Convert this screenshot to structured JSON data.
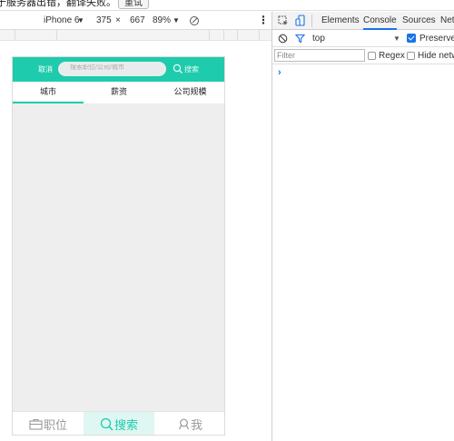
{
  "translate_bar": {
    "message": "于服务器出错，翻译失败。",
    "retry": "重试"
  },
  "device_toolbar": {
    "device": "iPhone 6",
    "device_arrow": "▼",
    "width": "375",
    "times": "×",
    "height": "667",
    "zoom": "89%",
    "zoom_arrow": "▼",
    "more": "⋮"
  },
  "app": {
    "cancel": "取消",
    "search_placeholder": "搜索职位/公司/城市",
    "search_button": "搜索",
    "tabs": [
      "城市",
      "薪资",
      "公司规模"
    ],
    "nav": {
      "jobs": "职位",
      "search": "搜索",
      "me": "我"
    },
    "accent": "#1ecbad"
  },
  "devtools": {
    "tabs": [
      "Elements",
      "Console",
      "Sources",
      "Net"
    ],
    "context": "top",
    "context_arrow": "▼",
    "preserve_log": "Preserve lo",
    "filter_placeholder": "Filter",
    "regex": "Regex",
    "hide_network": "Hide netwo",
    "prompt": "›"
  }
}
